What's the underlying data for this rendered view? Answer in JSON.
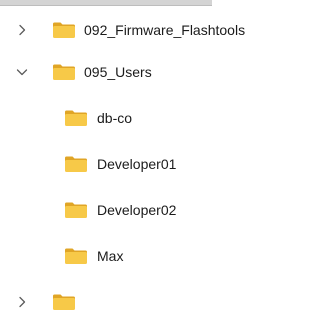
{
  "tree": {
    "items": [
      {
        "label": "092_Firmware_Flashtools",
        "expanded": false,
        "icon": "folder-icon"
      },
      {
        "label": "095_Users",
        "expanded": true,
        "icon": "folder-icon"
      },
      {
        "label": "db-co",
        "icon": "folder-icon"
      },
      {
        "label": "Developer01",
        "icon": "folder-icon"
      },
      {
        "label": "Developer02",
        "icon": "folder-icon"
      },
      {
        "label": "Max",
        "icon": "folder-icon"
      }
    ]
  },
  "colors": {
    "folder_body": "#f7c948",
    "folder_tab": "#e0a526",
    "chevron": "#5c5c5c"
  }
}
